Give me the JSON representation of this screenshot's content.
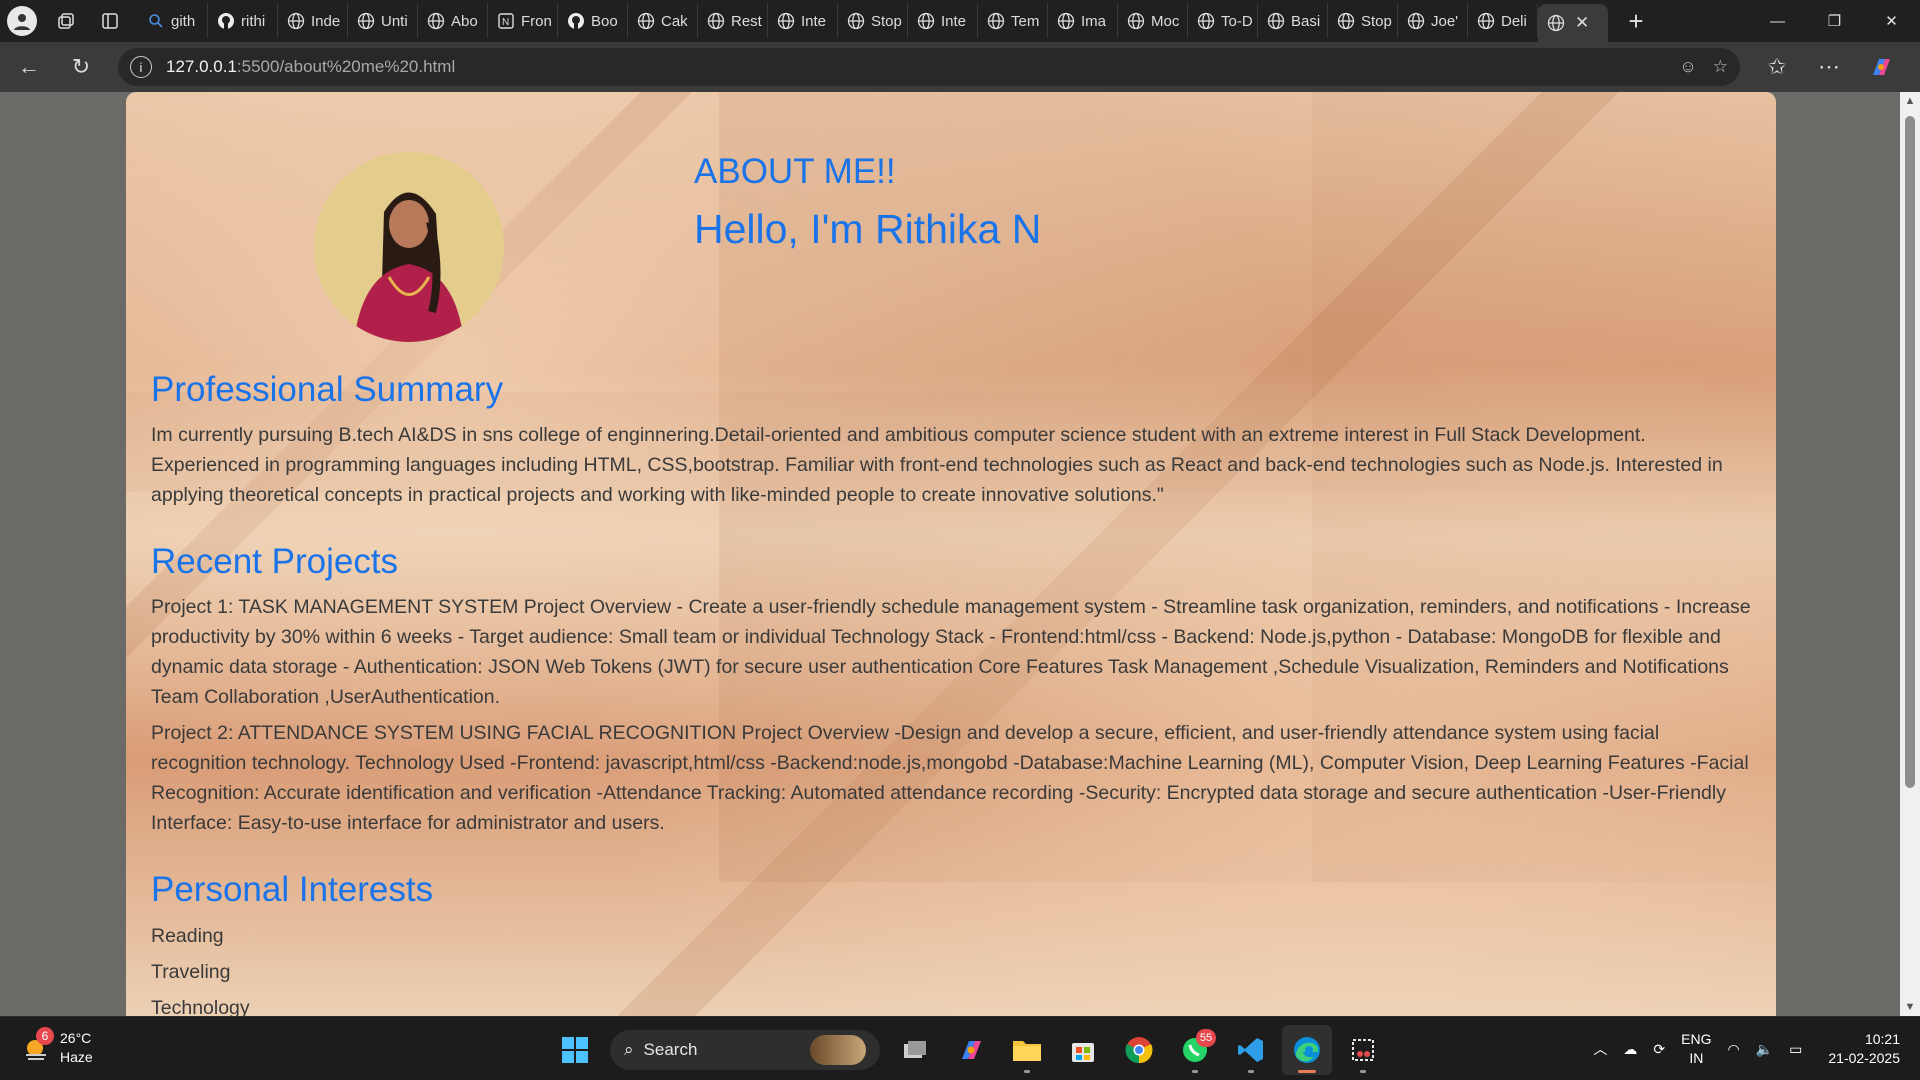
{
  "browser": {
    "tabs": [
      {
        "title": "gith",
        "icon": "search-icon"
      },
      {
        "title": "rithi",
        "icon": "github-icon"
      },
      {
        "title": "Inde",
        "icon": "globe-icon"
      },
      {
        "title": "Unti",
        "icon": "globe-icon"
      },
      {
        "title": "Abo",
        "icon": "globe-icon"
      },
      {
        "title": "Fron",
        "icon": "notion-icon"
      },
      {
        "title": "Boo",
        "icon": "github-icon"
      },
      {
        "title": "Cak",
        "icon": "globe-icon"
      },
      {
        "title": "Rest",
        "icon": "globe-icon"
      },
      {
        "title": "Inte",
        "icon": "globe-icon"
      },
      {
        "title": "Stop",
        "icon": "globe-icon"
      },
      {
        "title": "Inte",
        "icon": "globe-icon"
      },
      {
        "title": "Tem",
        "icon": "globe-icon"
      },
      {
        "title": "Ima",
        "icon": "globe-icon"
      },
      {
        "title": "Moc",
        "icon": "globe-icon"
      },
      {
        "title": "To-D",
        "icon": "globe-icon"
      },
      {
        "title": "Basi",
        "icon": "globe-icon"
      },
      {
        "title": "Stop",
        "icon": "globe-icon"
      },
      {
        "title": "Joe'",
        "icon": "globe-icon"
      },
      {
        "title": "Deli",
        "icon": "globe-icon"
      }
    ],
    "active_tab_icon": "globe-icon",
    "url_host": "127.0.0.1",
    "url_path": ":5500/about%20me%20.html"
  },
  "page": {
    "hero_title": "ABOUT ME!!",
    "hero_name": "Hello, I'm Rithika N",
    "summary_heading": "Professional Summary",
    "summary_text": "Im currently pursuing B.tech AI&DS in sns college of enginnering.Detail-oriented and ambitious computer science student with an extreme interest in Full Stack Development. Experienced in programming languages including HTML, CSS,bootstrap. Familiar with front-end technologies such as React and back-end technologies such as Node.js. Interested in applying theoretical concepts in practical projects and working with like-minded people to create innovative solutions.\"",
    "projects_heading": "Recent Projects",
    "project1": "Project 1: TASK MANAGEMENT SYSTEM Project Overview - Create a user-friendly schedule management system - Streamline task organization, reminders, and notifications - Increase productivity by 30% within 6 weeks - Target audience: Small team or individual Technology Stack - Frontend:html/css - Backend: Node.js,python - Database: MongoDB for flexible and dynamic data storage - Authentication: JSON Web Tokens (JWT) for secure user authentication Core Features Task Management ,Schedule Visualization, Reminders and Notifications Team Collaboration ,UserAuthentication.",
    "project2": "Project 2: ATTENDANCE SYSTEM USING FACIAL RECOGNITION Project Overview -Design and develop a secure, efficient, and user-friendly attendance system using facial recognition technology. Technology Used -Frontend: javascript,html/css -Backend:node.js,mongobd -Database:Machine Learning (ML), Computer Vision, Deep Learning Features -Facial Recognition: Accurate identification and verification -Attendance Tracking: Automated attendance recording -Security: Encrypted data storage and secure authentication -User-Friendly Interface: Easy-to-use interface for administrator and users.",
    "interests_heading": "Personal Interests",
    "interests": [
      "Reading",
      "Traveling",
      "Technology"
    ],
    "heading_color": "#1a73e8"
  },
  "taskbar": {
    "weather_temp": "26°C",
    "weather_desc": "Haze",
    "weather_badge": "6",
    "search_label": "Search",
    "whatsapp_badge": "55",
    "lang_line1": "ENG",
    "lang_line2": "IN",
    "time": "10:21",
    "date": "21-02-2025"
  }
}
